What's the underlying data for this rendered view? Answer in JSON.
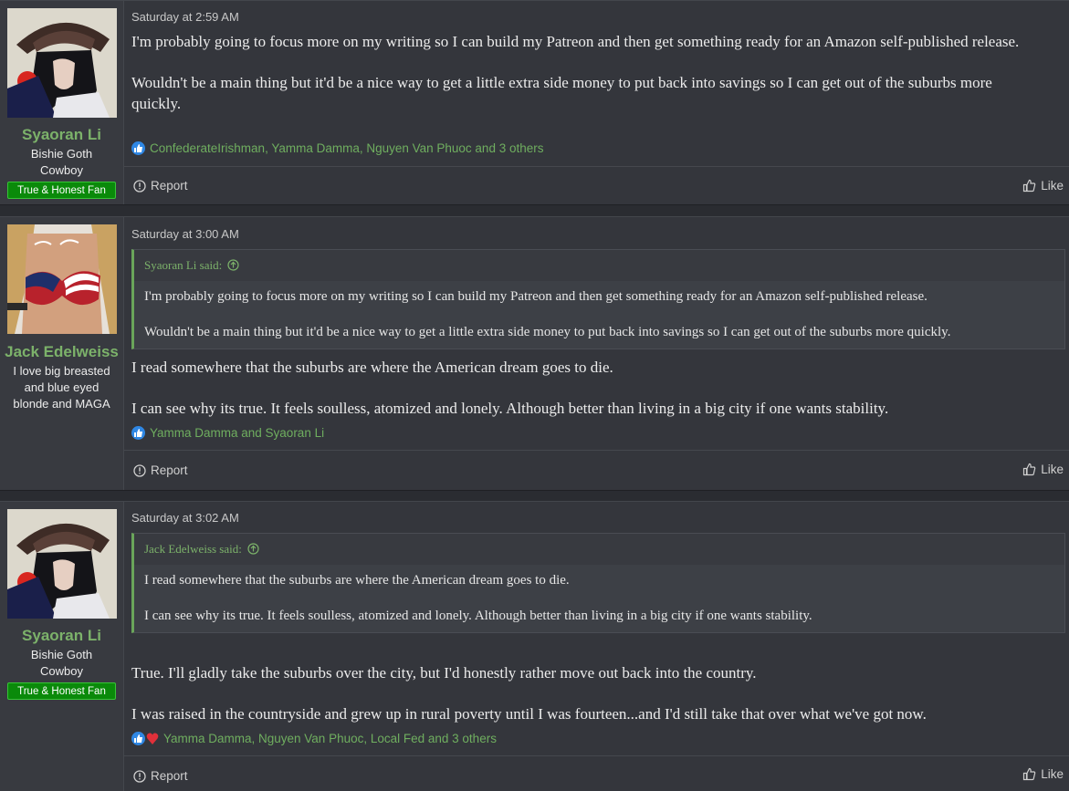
{
  "posts": [
    {
      "username": "Syaoran Li",
      "user_title_lines": [
        "Bishie Goth",
        "Cowboy"
      ],
      "banner": "True & Honest Fan",
      "date": "Saturday at 2:59 AM",
      "body": [
        "I'm probably going to focus more on my writing so I can build my Patreon and then get something ready for an Amazon self-published release.",
        "Wouldn't be a main thing but it'd be a nice way to get a little extra side money to put back into savings so I can get out of the suburbs more quickly."
      ],
      "reactions": "ConfederateIrishman, Yamma Damma, Nguyen Van Phuoc and 3 others",
      "report_label": "Report",
      "like_label": "Like"
    },
    {
      "username": "Jack Edelweiss",
      "user_title_lines": [
        "I love big breasted",
        "and blue eyed",
        "blonde and MAGA"
      ],
      "date": "Saturday at 3:00 AM",
      "quote": {
        "author": "Syaoran Li said:",
        "lines": [
          "I'm probably going to focus more on my writing so I can build my Patreon and then get something ready for an Amazon self-published release.",
          "Wouldn't be a main thing but it'd be a nice way to get a little extra side money to put back into savings so I can get out of the suburbs more quickly."
        ]
      },
      "body": [
        "I read somewhere that the suburbs are where the American dream goes to die.",
        "I can see why its true. It feels soulless, atomized and lonely. Although better than living in a big city if one wants stability."
      ],
      "reactions": "Yamma Damma and Syaoran Li",
      "report_label": "Report",
      "like_label": "Like"
    },
    {
      "username": "Syaoran Li",
      "user_title_lines": [
        "Bishie Goth",
        "Cowboy"
      ],
      "banner": "True & Honest Fan",
      "date": "Saturday at 3:02 AM",
      "quote": {
        "author": "Jack Edelweiss said:",
        "lines": [
          "I read somewhere that the suburbs are where the American dream goes to die.",
          "I can see why its true. It feels soulless, atomized and lonely. Although better than living in a big city if one wants stability."
        ]
      },
      "body": [
        "True. I'll gladly take the suburbs over the city, but I'd honestly rather move out back into the country.",
        "I was raised in the countryside and grew up in rural poverty until I was fourteen...and I'd still take that over what we've got now."
      ],
      "reactions": "Yamma Damma, Nguyen Van Phuoc, Local Fed and 3 others",
      "report_label": "Report",
      "like_label": "Like"
    }
  ],
  "colors": {
    "background": "#2a2c31",
    "post_bg": "#34363c",
    "username": "#7cb26a",
    "banner_bg": "#0a8a0a",
    "like_reaction": "#2f87e4",
    "love_reaction": "#e0303a"
  },
  "icons": {
    "like_reaction": "thumbs-up-icon",
    "love_reaction": "heart-icon",
    "quote_jump": "arrow-up-circle-icon",
    "report": "report-icon",
    "like": "like-icon"
  }
}
